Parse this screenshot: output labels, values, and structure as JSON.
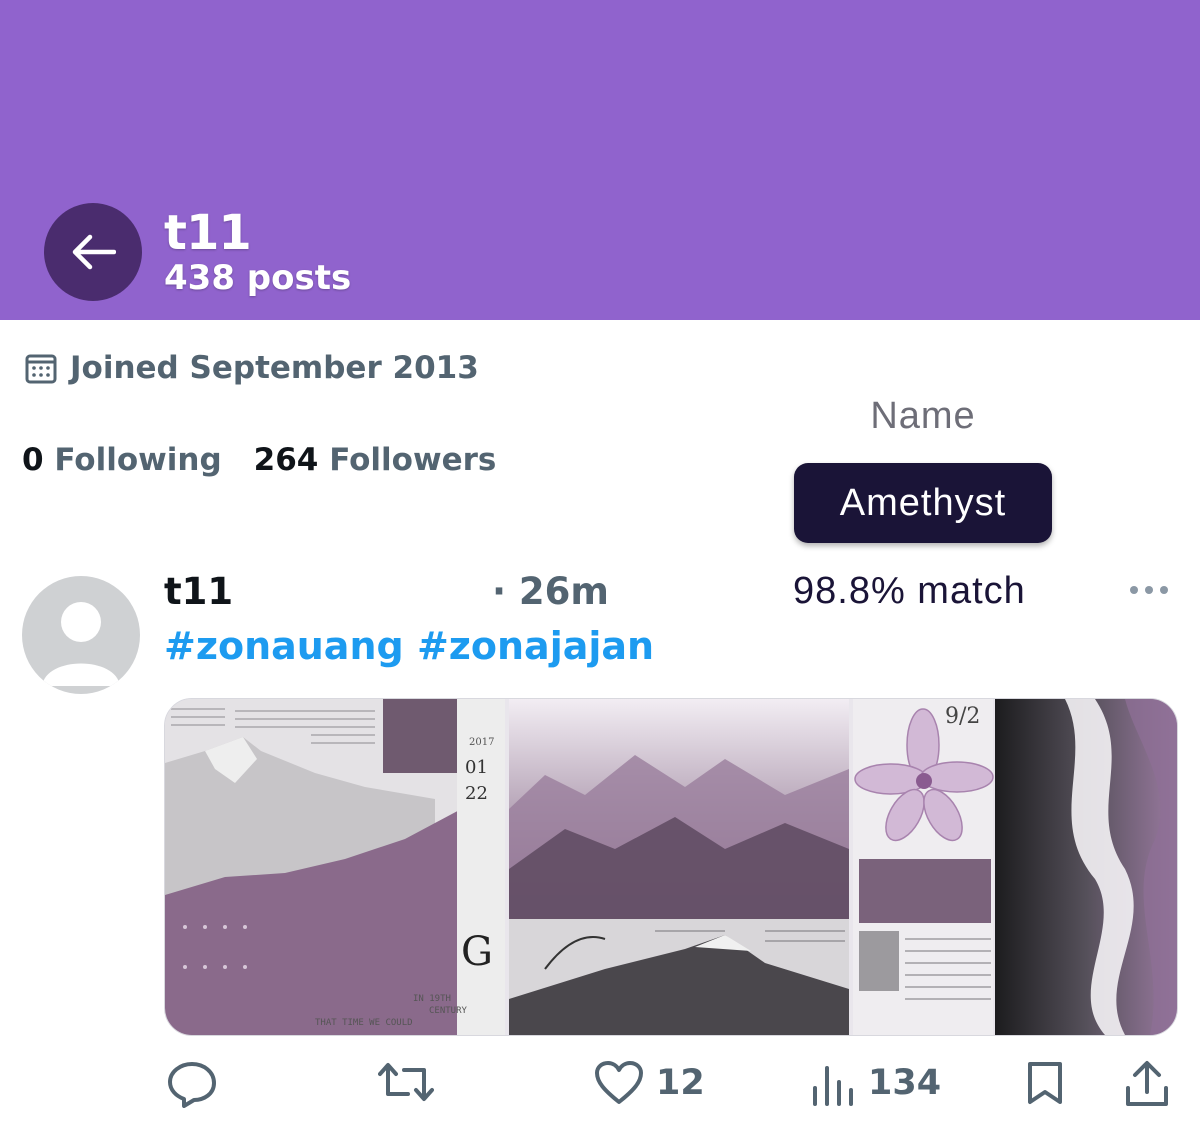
{
  "header": {
    "name": "t11",
    "posts": "438 posts",
    "color": "#9063cd"
  },
  "profile": {
    "joined": "Joined September 2013",
    "following_count": "0",
    "following_label": "Following",
    "followers_count": "264",
    "followers_label": "Followers"
  },
  "overlay": {
    "name_label": "Name",
    "name_value": "Amethyst",
    "match": "98.8% match"
  },
  "tweet": {
    "author": "t11",
    "time": "· 26m",
    "hashtags": "#zonauang #zonajajan",
    "media_texts": {
      "num_01": "01",
      "num_22": "22",
      "date": "9/2",
      "letter": "G",
      "year": "2017",
      "caption_1": "IN 19TH",
      "caption_2": "CENTURY",
      "caption_3": "THAT TIME WE COULD"
    },
    "actions": {
      "reply_count": "",
      "retweet_count": "",
      "like_count": "12",
      "views_count": "134"
    }
  },
  "icons": [
    "back-arrow-icon",
    "calendar-icon",
    "more-icon",
    "reply-icon",
    "retweet-icon",
    "heart-icon",
    "views-icon",
    "bookmark-icon",
    "share-icon"
  ]
}
